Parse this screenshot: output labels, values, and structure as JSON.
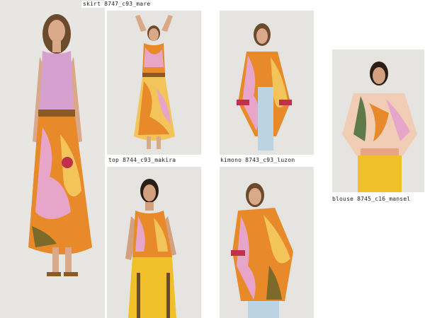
{
  "captions": {
    "skirt": "skirt 8747_c93_mare",
    "top": "top 8744_c93_makira",
    "kimono": "kimono 8743_c93_luzon",
    "blouse": "blouse 8745_c16_mansel"
  },
  "colors": {
    "background": "#ffffff",
    "photo_bg": "#e6e4e1",
    "print_orange": "#e88a2a",
    "print_pink": "#e7a6c9",
    "print_yellow": "#f2c45a",
    "print_olive": "#7c6a2a",
    "pants_yellow": "#f0c02a",
    "top_lilac": "#d6a0cf",
    "jeans_blue": "#bcd3e3"
  }
}
